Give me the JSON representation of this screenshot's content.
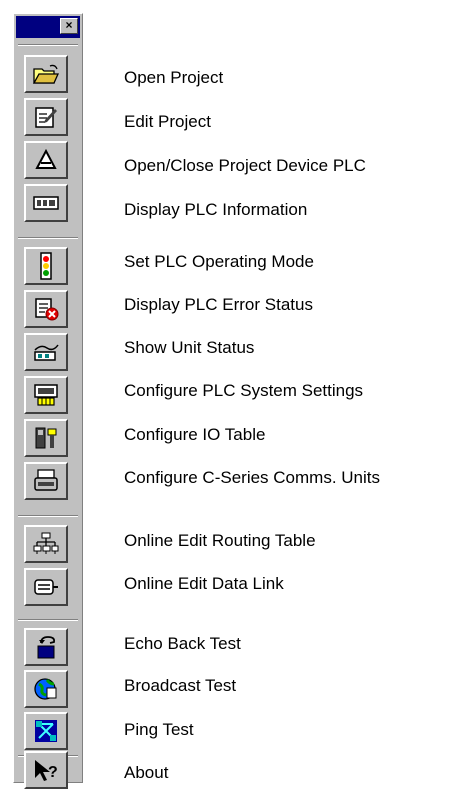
{
  "toolbar": {
    "close_glyph": "×",
    "items": [
      {
        "label": "Open Project",
        "icon": "folder-open-icon"
      },
      {
        "label": "Edit Project",
        "icon": "edit-document-icon"
      },
      {
        "label": "Open/Close Project Device PLC",
        "icon": "plc-connect-icon"
      },
      {
        "label": "Display PLC Information",
        "icon": "plc-info-icon"
      },
      {
        "label": "Set PLC Operating Mode",
        "icon": "traffic-light-icon"
      },
      {
        "label": "Display PLC Error Status",
        "icon": "error-status-icon"
      },
      {
        "label": "Show Unit Status",
        "icon": "unit-status-icon"
      },
      {
        "label": "Configure PLC System Settings",
        "icon": "system-settings-icon"
      },
      {
        "label": "Configure IO Table",
        "icon": "io-table-icon"
      },
      {
        "label": "Configure C-Series Comms. Units",
        "icon": "comms-unit-icon"
      },
      {
        "label": "Online Edit Routing Table",
        "icon": "routing-table-icon"
      },
      {
        "label": "Online Edit Data Link",
        "icon": "data-link-icon"
      },
      {
        "label": "Echo Back Test",
        "icon": "echo-back-icon"
      },
      {
        "label": "Broadcast Test",
        "icon": "globe-broadcast-icon"
      },
      {
        "label": "Ping Test",
        "icon": "ping-network-icon"
      },
      {
        "label": "About",
        "icon": "help-pointer-icon"
      }
    ]
  }
}
